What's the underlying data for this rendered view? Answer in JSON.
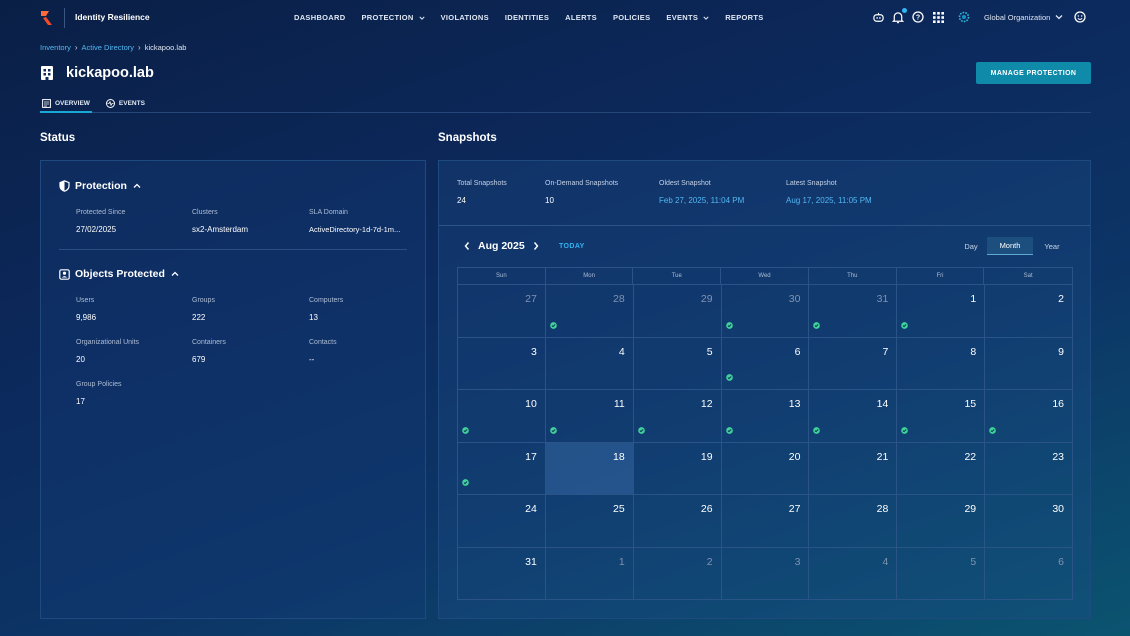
{
  "header": {
    "app_title": "Identity Resilience",
    "nav": [
      {
        "label": "DASHBOARD",
        "dropdown": false
      },
      {
        "label": "PROTECTION",
        "dropdown": true
      },
      {
        "label": "VIOLATIONS",
        "dropdown": false
      },
      {
        "label": "IDENTITIES",
        "dropdown": false
      },
      {
        "label": "ALERTS",
        "dropdown": false
      },
      {
        "label": "POLICIES",
        "dropdown": false
      },
      {
        "label": "EVENTS",
        "dropdown": true
      },
      {
        "label": "REPORTS",
        "dropdown": false
      }
    ],
    "icons": [
      "assistant-icon",
      "bell-icon",
      "help-icon",
      "apps-grid-icon"
    ],
    "org_label": "Global Organization"
  },
  "breadcrumb": {
    "items": [
      "Inventory",
      "Active Directory"
    ],
    "current": "kickapoo.lab"
  },
  "page": {
    "title": "kickapoo.lab",
    "manage_button": "MANAGE PROTECTION",
    "tabs": [
      {
        "label": "OVERVIEW",
        "active": true
      },
      {
        "label": "EVENTS",
        "active": false
      }
    ]
  },
  "status": {
    "section_title": "Status",
    "protection": {
      "title": "Protection",
      "fields": [
        {
          "label": "Protected Since",
          "value": "27/02/2025"
        },
        {
          "label": "Clusters",
          "value": "sx2-Amsterdam"
        },
        {
          "label": "SLA Domain",
          "value": "ActiveDirectory-1d-7d-1m..."
        }
      ]
    },
    "objects": {
      "title": "Objects Protected",
      "fields": [
        {
          "label": "Users",
          "value": "9,986"
        },
        {
          "label": "Groups",
          "value": "222"
        },
        {
          "label": "Computers",
          "value": "13"
        },
        {
          "label": "Organizational Units",
          "value": "20"
        },
        {
          "label": "Containers",
          "value": "679"
        },
        {
          "label": "Contacts",
          "value": "--"
        },
        {
          "label": "Group Policies",
          "value": "17"
        }
      ]
    }
  },
  "snapshots": {
    "section_title": "Snapshots",
    "summary": [
      {
        "label": "Total Snapshots",
        "value": "24",
        "link": false
      },
      {
        "label": "On-Demand Snapshots",
        "value": "10",
        "link": false
      },
      {
        "label": "Oldest Snapshot",
        "value": "Feb 27, 2025, 11:04 PM",
        "link": true
      },
      {
        "label": "Latest Snapshot",
        "value": "Aug 17, 2025, 11:05 PM",
        "link": true
      }
    ],
    "calendar": {
      "month_label": "Aug 2025",
      "today_label": "TODAY",
      "views": [
        "Day",
        "Month",
        "Year"
      ],
      "selected_view": "Month",
      "weekdays": [
        "Sun",
        "Mon",
        "Tue",
        "Wed",
        "Thu",
        "Fri",
        "Sat"
      ],
      "colors": {
        "snapshot_dot": "#3fd39a",
        "accent": "#0f8aa8"
      },
      "weeks": [
        [
          {
            "d": "27",
            "o": true,
            "s": false
          },
          {
            "d": "28",
            "o": true,
            "s": true
          },
          {
            "d": "29",
            "o": true,
            "s": false
          },
          {
            "d": "30",
            "o": true,
            "s": true
          },
          {
            "d": "31",
            "o": true,
            "s": true
          },
          {
            "d": "1",
            "o": false,
            "s": true
          },
          {
            "d": "2",
            "o": false,
            "s": false
          }
        ],
        [
          {
            "d": "3",
            "o": false,
            "s": false
          },
          {
            "d": "4",
            "o": false,
            "s": false
          },
          {
            "d": "5",
            "o": false,
            "s": false
          },
          {
            "d": "6",
            "o": false,
            "s": true
          },
          {
            "d": "7",
            "o": false,
            "s": false
          },
          {
            "d": "8",
            "o": false,
            "s": false
          },
          {
            "d": "9",
            "o": false,
            "s": false
          }
        ],
        [
          {
            "d": "10",
            "o": false,
            "s": true
          },
          {
            "d": "11",
            "o": false,
            "s": true
          },
          {
            "d": "12",
            "o": false,
            "s": true
          },
          {
            "d": "13",
            "o": false,
            "s": true
          },
          {
            "d": "14",
            "o": false,
            "s": true
          },
          {
            "d": "15",
            "o": false,
            "s": true
          },
          {
            "d": "16",
            "o": false,
            "s": true
          }
        ],
        [
          {
            "d": "17",
            "o": false,
            "s": true
          },
          {
            "d": "18",
            "o": false,
            "s": false,
            "today": true
          },
          {
            "d": "19",
            "o": false,
            "s": false
          },
          {
            "d": "20",
            "o": false,
            "s": false
          },
          {
            "d": "21",
            "o": false,
            "s": false
          },
          {
            "d": "22",
            "o": false,
            "s": false
          },
          {
            "d": "23",
            "o": false,
            "s": false
          }
        ],
        [
          {
            "d": "24",
            "o": false,
            "s": false
          },
          {
            "d": "25",
            "o": false,
            "s": false
          },
          {
            "d": "26",
            "o": false,
            "s": false
          },
          {
            "d": "27",
            "o": false,
            "s": false
          },
          {
            "d": "28",
            "o": false,
            "s": false
          },
          {
            "d": "29",
            "o": false,
            "s": false
          },
          {
            "d": "30",
            "o": false,
            "s": false
          }
        ],
        [
          {
            "d": "31",
            "o": false,
            "s": false
          },
          {
            "d": "1",
            "o": true,
            "s": false
          },
          {
            "d": "2",
            "o": true,
            "s": false
          },
          {
            "d": "3",
            "o": true,
            "s": false
          },
          {
            "d": "4",
            "o": true,
            "s": false
          },
          {
            "d": "5",
            "o": true,
            "s": false
          },
          {
            "d": "6",
            "o": true,
            "s": false
          }
        ]
      ]
    }
  }
}
